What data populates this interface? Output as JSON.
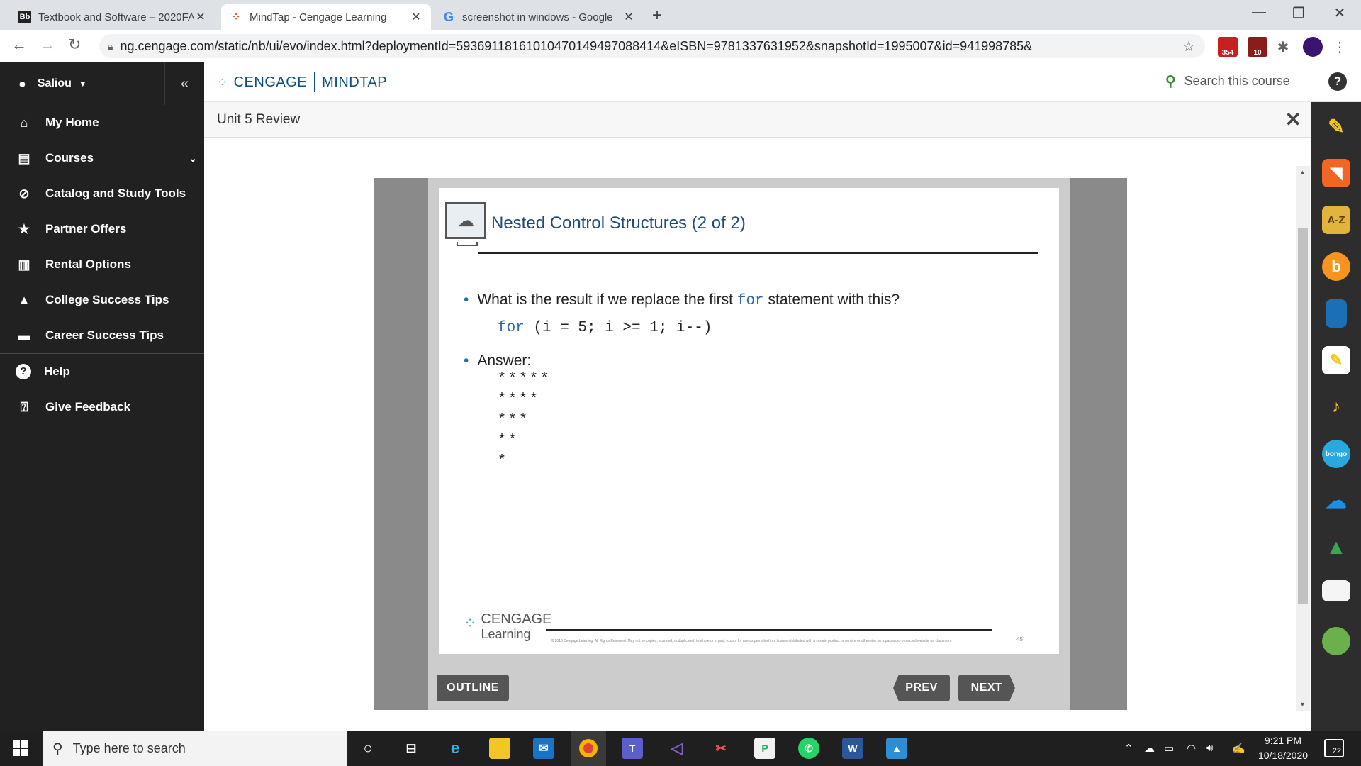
{
  "browser": {
    "tabs": [
      {
        "title": "Textbook and Software – 2020FA",
        "favicon": "Bb"
      },
      {
        "title": "MindTap - Cengage Learning",
        "favicon": "cengage-dots"
      },
      {
        "title": "screenshot in windows - Google",
        "favicon": "G"
      }
    ],
    "active_tab": 1,
    "url": "ng.cengage.com/static/nb/ui/evo/index.html?deploymentId=5936911816101047014949708841​4&eISBN=9781337631952&snapshotId=1995007&id=941998785&",
    "ext_badge_mail": "354",
    "ext_badge_2": "10"
  },
  "sidebar": {
    "user_name": "Saliou",
    "items": [
      {
        "label": "My Home",
        "icon": "home-icon"
      },
      {
        "label": "Courses",
        "icon": "book-icon"
      },
      {
        "label": "Catalog and Study Tools",
        "icon": "compass-icon"
      },
      {
        "label": "Partner Offers",
        "icon": "star-icon"
      },
      {
        "label": "Rental Options",
        "icon": "open-book-icon"
      },
      {
        "label": "College Success Tips",
        "icon": "graduation-cap-icon"
      },
      {
        "label": "Career Success Tips",
        "icon": "briefcase-icon"
      },
      {
        "label": "Help",
        "icon": "question-icon"
      },
      {
        "label": "Give Feedback",
        "icon": "feedback-icon"
      }
    ]
  },
  "header": {
    "brand_left": "CENGAGE",
    "brand_right": "MINDTAP",
    "search_placeholder": "Search this course",
    "help_label": "?"
  },
  "activity": {
    "title": "Unit 5 Review",
    "close_label": "✕"
  },
  "slide": {
    "title": "Nested Control Structures (2 of 2)",
    "q_prefix": "What is the result if we replace the first ",
    "q_keyword": "for",
    "q_suffix": " statement with this?",
    "code_keyword": "for",
    "code_rest": " (i = 5; i >= 1; i--)",
    "answer_label": "Answer:",
    "answer_lines": [
      "*****",
      "****",
      "***",
      "**",
      "*"
    ],
    "logo_line1": "CENGAGE",
    "logo_line2": "Learning",
    "copyright": "© 2018 Cengage Learning. All Rights Reserved. May not be copied, scanned, or duplicated, in whole or in part, except for use as permitted in a license distributed with a certain product or service or otherwise on a password-protected website for classroom",
    "page_number": "45"
  },
  "viewer": {
    "outline_label": "OUTLINE",
    "prev_label": "PREV",
    "next_label": "NEXT"
  },
  "dock": {
    "items": [
      "pencil-icon",
      "rss-icon",
      "a-z-icon",
      "b-icon",
      "notebook-icon",
      "notes-icon",
      "audio-icon",
      "bongo-icon",
      "onedrive-icon",
      "google-drive-icon",
      "flashcards-icon",
      "circle-app-icon"
    ],
    "az_label": "A-Z",
    "bongo_label": "bongo"
  },
  "taskbar": {
    "search_placeholder": "Type here to search",
    "time": "9:21 PM",
    "date": "10/18/2020",
    "notification_count": "22"
  },
  "colors": {
    "sidebar_bg": "#212121",
    "brand_blue": "#0b4f80",
    "slide_title": "#1e4d7b",
    "keyword": "#2b6aa3",
    "button_gray": "#555555"
  }
}
